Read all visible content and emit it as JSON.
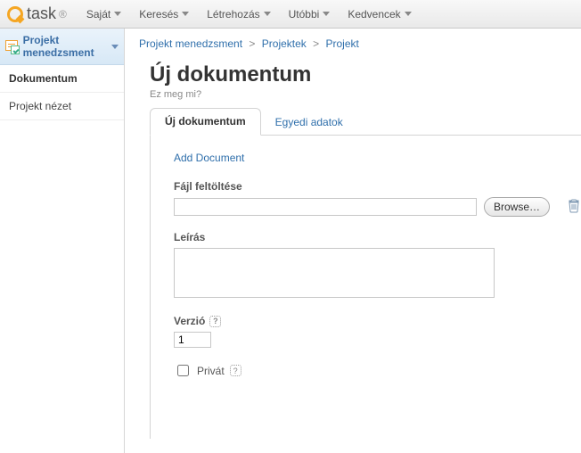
{
  "logo": {
    "text": "task",
    "suffix": "®"
  },
  "topmenu": [
    {
      "label": "Saját"
    },
    {
      "label": "Keresés"
    },
    {
      "label": "Létrehozás"
    },
    {
      "label": "Utóbbi"
    },
    {
      "label": "Kedvencek"
    }
  ],
  "sidebar": {
    "header": "Projekt menedzsment",
    "items": [
      {
        "label": "Dokumentum",
        "active": true
      },
      {
        "label": "Projekt nézet",
        "active": false
      }
    ]
  },
  "breadcrumb": {
    "a": "Projekt menedzsment",
    "b": "Projektek",
    "c": "Projekt"
  },
  "page": {
    "title": "Új dokumentum",
    "hint": "Ez meg mi?"
  },
  "tabs": [
    {
      "label": "Új dokumentum",
      "active": true
    },
    {
      "label": "Egyedi adatok",
      "active": false
    }
  ],
  "form": {
    "add_link": "Add Document",
    "file_label": "Fájl feltöltése",
    "file_value": "",
    "browse_label": "Browse…",
    "desc_label": "Leírás",
    "desc_value": "",
    "version_label": "Verzió",
    "version_value": "1",
    "privat_label": "Privát",
    "help_glyph": "?"
  }
}
